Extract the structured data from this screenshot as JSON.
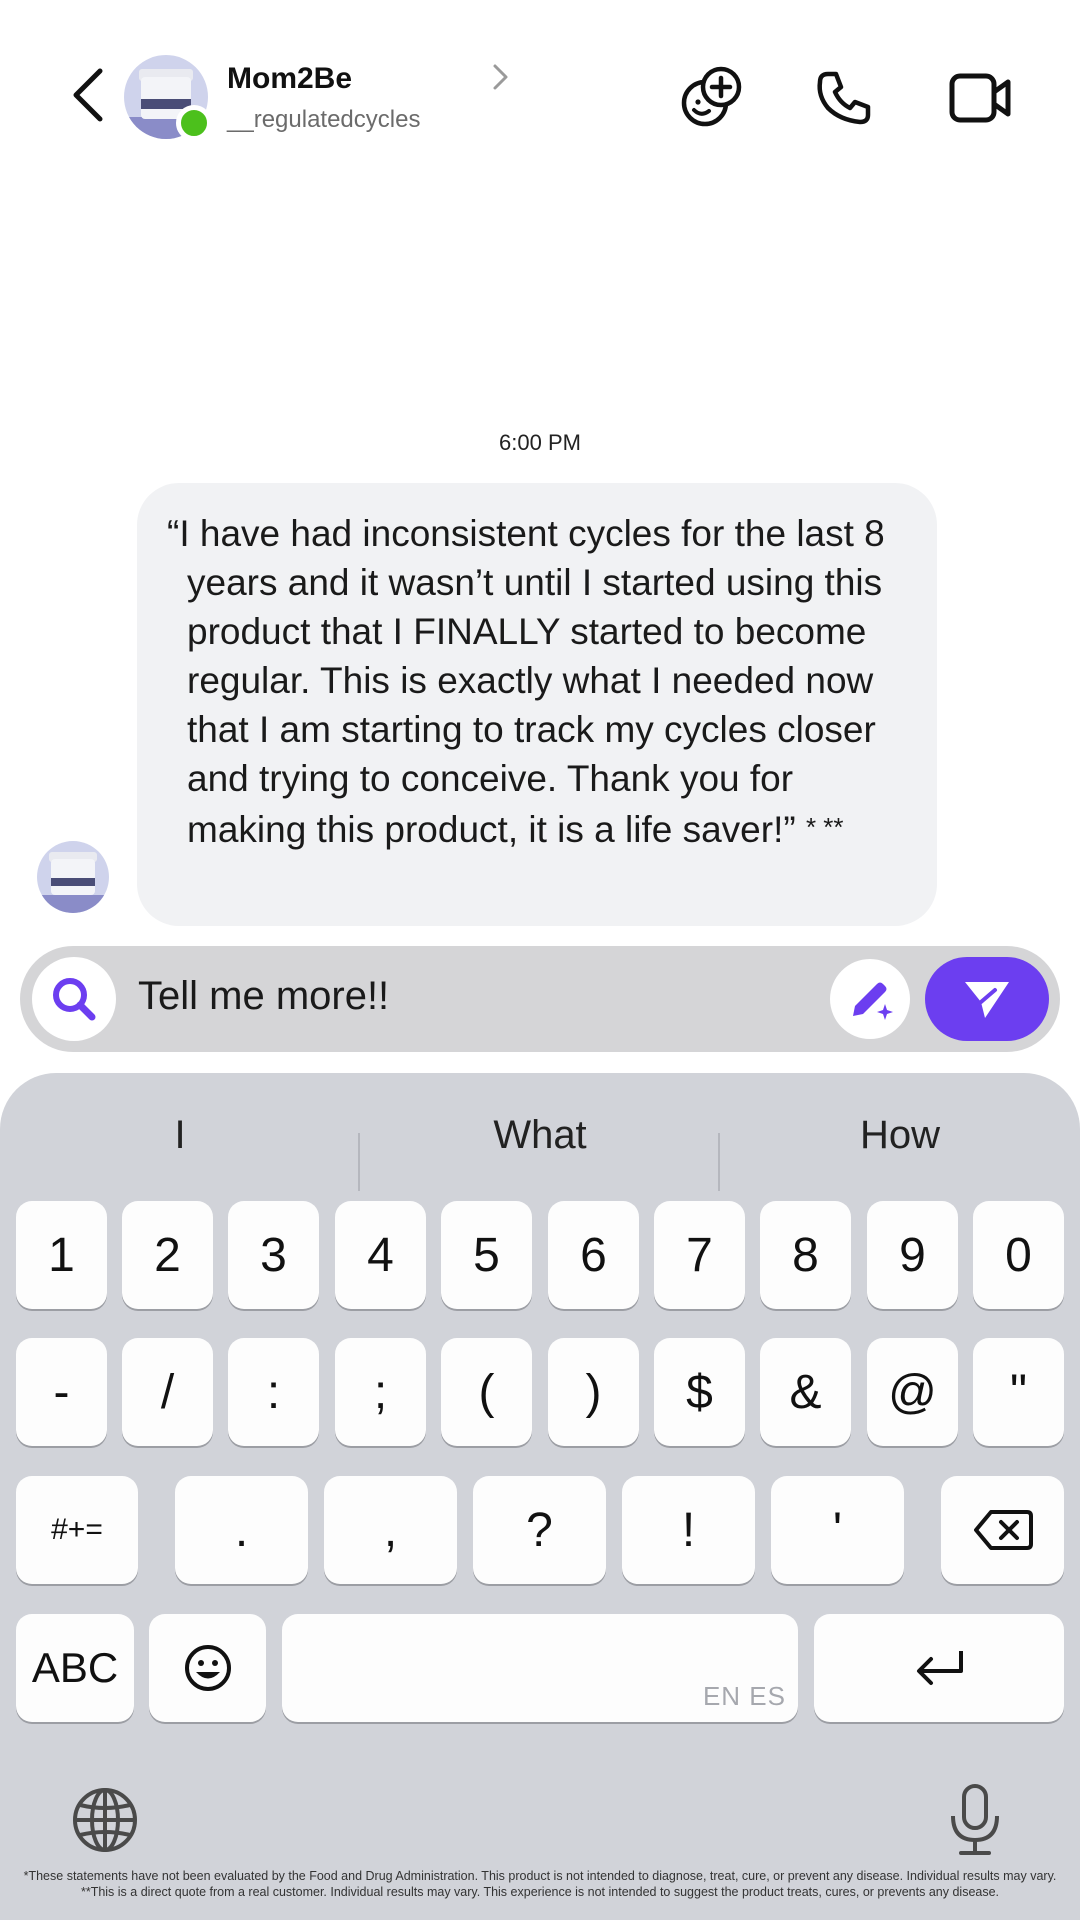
{
  "header": {
    "contact_name": "Mom2Be",
    "contact_handle": "__regulatedcycles",
    "icons": [
      "back-arrow-icon",
      "chevron-right-icon",
      "add-friend-icon",
      "phone-icon",
      "video-icon"
    ]
  },
  "chat": {
    "timestamp": "6:00 PM",
    "message": "“I have had inconsistent cycles for the last 8 years and it wasn’t until I started using this product that I FINALLY started to become regular. This is exactly what I needed now that I am starting to track my cycles closer and trying to conceive. Thank you for making this product, it is a life saver!”",
    "message_marks": "* **"
  },
  "input": {
    "value": "Tell me more!!"
  },
  "keyboard": {
    "suggestions": [
      "I",
      "What",
      "How"
    ],
    "row1": [
      "1",
      "2",
      "3",
      "4",
      "5",
      "6",
      "7",
      "8",
      "9",
      "0"
    ],
    "row2": [
      "-",
      "/",
      ":",
      ";",
      "(",
      ")",
      "$",
      "&",
      "@",
      "\""
    ],
    "row3": [
      "#+=",
      ".",
      ",",
      "?",
      "!",
      "'"
    ],
    "abc_label": "ABC",
    "space_lang": "EN ES"
  },
  "disclaimer": {
    "line1": "*These statements have not been evaluated by the Food and Drug Administration. This product is not intended to diagnose, treat, cure, or prevent any disease. Individual results may vary.",
    "line2": "**This is a direct quote from a real customer. Individual results may vary. This experience is not intended to suggest the product treats, cures, or prevents any disease."
  },
  "colors": {
    "accent": "#6c3ef0",
    "online": "#4cc01c",
    "bubble": "#f1f2f4",
    "keyboard_bg": "#d1d3d9"
  }
}
